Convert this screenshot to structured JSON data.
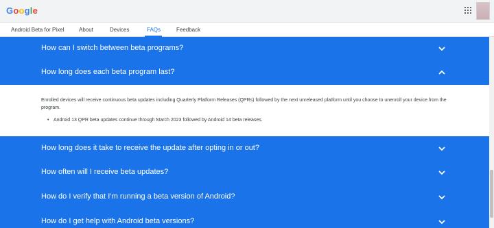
{
  "header": {
    "logo_letters": [
      {
        "ch": "G",
        "color": "#4285f4"
      },
      {
        "ch": "o",
        "color": "#ea4335"
      },
      {
        "ch": "o",
        "color": "#fbbc05"
      },
      {
        "ch": "g",
        "color": "#4285f4"
      },
      {
        "ch": "l",
        "color": "#34a853"
      },
      {
        "ch": "e",
        "color": "#ea4335"
      }
    ],
    "apps_icon": "apps-grid-icon"
  },
  "nav": {
    "items": [
      {
        "label": "Android Beta for Pixel",
        "active": false
      },
      {
        "label": "About",
        "active": false
      },
      {
        "label": "Devices",
        "active": false
      },
      {
        "label": "FAQs",
        "active": true
      },
      {
        "label": "Feedback",
        "active": false
      }
    ]
  },
  "faqs": [
    {
      "question": "How can I switch between beta programs?",
      "expanded": false
    },
    {
      "question": "How long does each beta program last?",
      "expanded": true
    },
    {
      "question": "How long does it take to receive the update after opting in or out?",
      "expanded": false
    },
    {
      "question": "How often will I receive beta updates?",
      "expanded": false
    },
    {
      "question": "How do I verify that I’m running a beta version of Android?",
      "expanded": false
    },
    {
      "question": "How do I get help with Android beta versions?",
      "expanded": false
    }
  ],
  "answer": {
    "paragraph": "Enrolled devices will receive continuous beta updates including Quarterly Platform Releases (QPRs) followed by the next unreleased platform until you choose to unenroll your device from the program.",
    "bullets": [
      "Android 13 QPR beta updates continue through March 2023 followed by Android 14 beta releases."
    ]
  },
  "colors": {
    "accent": "#1a73e8",
    "text": "#3c4043"
  }
}
